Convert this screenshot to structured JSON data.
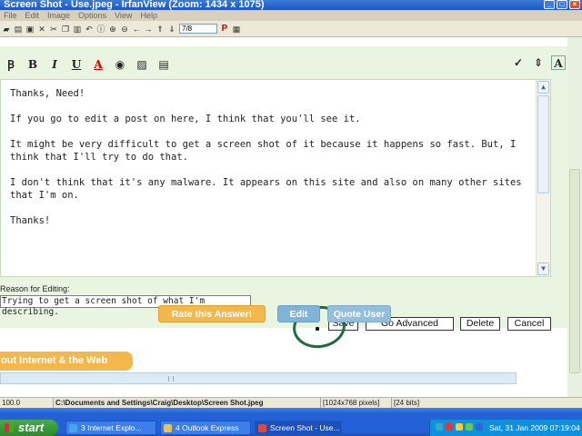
{
  "window": {
    "title": "Screen Shot - Use.jpeg - IrfanView (Zoom: 1434 x 1075)",
    "controls": [
      "_",
      "□",
      "×"
    ]
  },
  "menu": [
    "File",
    "Edit",
    "Image",
    "Options",
    "View",
    "Help"
  ],
  "toolbar": {
    "page_value": "7/8"
  },
  "editor_toolbar": {
    "bold": "B",
    "italic": "I",
    "underline": "U",
    "font_color": "A"
  },
  "post": {
    "paragraphs": [
      "Thanks, Need!",
      "If you go to edit a post on here, I think that you'll see it.",
      "It might be very difficult to get a screen shot of it because it happens so fast. But, I think that I'll try to do that.",
      "I don't think that it's any malware. It appears on this site and also on many other sites that I'm on.",
      "Thanks!"
    ]
  },
  "reason": {
    "label": "Reason for Editing:",
    "value": "Trying to get a screen shot of what I'm describing."
  },
  "buttons": {
    "save": "Save",
    "go_advanced": "Go Advanced",
    "delete": "Delete",
    "cancel": "Cancel",
    "rate": "Rate this Answer!",
    "edit": "Edit",
    "quote_user": "Quote User"
  },
  "section_tab": "out Internet & the Web",
  "statusbar": {
    "zoom": "100.0",
    "path": "C:\\Documents and Settings\\Craig\\Desktop\\Screen Shot.jpeg",
    "size": "1024x768 pixels",
    "bits": "24 bits"
  },
  "taskbar": {
    "start": "start",
    "tasks": [
      "3 Internet Explo...",
      "4 Outlook Express",
      "Screen Shot - Use..."
    ],
    "clock": "Sat, 31 Jan 2009 07:19:04"
  },
  "colors": {
    "title_blue": "#1b56c9",
    "editor_green": "#e9f5e1",
    "orange_button": "#f2b84b",
    "blue_button": "#7fb4d6",
    "circle_green": "#1d6b3f",
    "taskbar_blue": "#2461d6"
  }
}
